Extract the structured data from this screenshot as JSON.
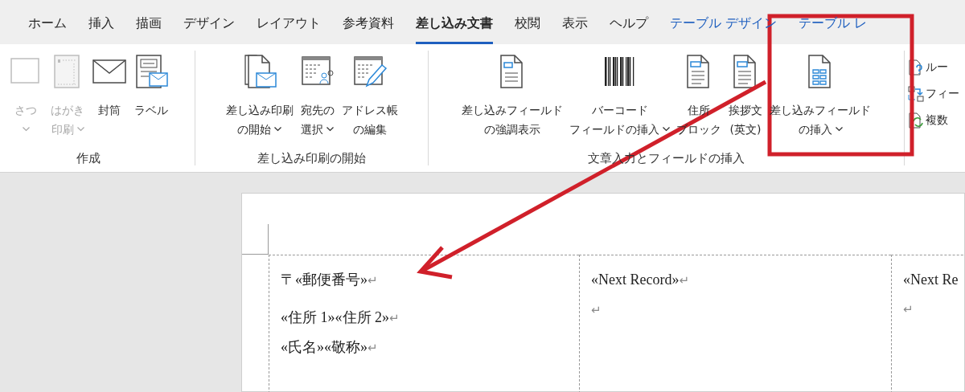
{
  "tabs": [
    {
      "label": "ホーム",
      "selected": false,
      "kind": "normal"
    },
    {
      "label": "挿入",
      "selected": false,
      "kind": "normal"
    },
    {
      "label": "描画",
      "selected": false,
      "kind": "normal"
    },
    {
      "label": "デザイン",
      "selected": false,
      "kind": "normal"
    },
    {
      "label": "レイアウト",
      "selected": false,
      "kind": "normal"
    },
    {
      "label": "参考資料",
      "selected": false,
      "kind": "normal"
    },
    {
      "label": "差し込み文書",
      "selected": true,
      "kind": "normal"
    },
    {
      "label": "校閲",
      "selected": false,
      "kind": "normal"
    },
    {
      "label": "表示",
      "selected": false,
      "kind": "normal"
    },
    {
      "label": "ヘルプ",
      "selected": false,
      "kind": "normal"
    },
    {
      "label": "テーブル デザイン",
      "selected": false,
      "kind": "contextual"
    },
    {
      "label": "テーブル レ",
      "selected": false,
      "kind": "contextual"
    }
  ],
  "ribbon_groups": [
    {
      "label": "作成",
      "buttons": [
        {
          "kind": "card",
          "lines": [
            "さつ"
          ],
          "caret": true,
          "disabled": true
        },
        {
          "kind": "postcard",
          "lines": [
            "はがき",
            "印刷"
          ],
          "caret": true,
          "disabled": true
        },
        {
          "kind": "envelope",
          "lines": [
            "封筒"
          ],
          "caret": false,
          "disabled": false
        },
        {
          "kind": "label",
          "lines": [
            "ラベル"
          ],
          "caret": false,
          "disabled": false
        }
      ]
    },
    {
      "label": "差し込み印刷の開始",
      "buttons": [
        {
          "kind": "merge",
          "lines": [
            "差し込み印刷",
            "の開始"
          ],
          "caret": true,
          "disabled": false
        },
        {
          "kind": "recipients",
          "lines": [
            "宛先の",
            "選択"
          ],
          "caret": true,
          "disabled": false
        },
        {
          "kind": "list",
          "lines": [
            "アドレス帳",
            "の編集"
          ],
          "caret": false,
          "disabled": false
        }
      ]
    },
    {
      "label": "文章入力とフィールドの挿入",
      "buttons": [
        {
          "kind": "highlight",
          "lines": [
            "差し込みフィールド",
            "の強調表示"
          ],
          "caret": false,
          "disabled": false
        },
        {
          "kind": "barcode",
          "lines": [
            "バーコード",
            "フィールドの挿入"
          ],
          "caret": true,
          "disabled": false
        },
        {
          "kind": "block",
          "lines": [
            "住所",
            "ブロック"
          ],
          "caret": false,
          "disabled": false
        },
        {
          "kind": "block",
          "lines": [
            "挨拶文",
            "(英文)"
          ],
          "caret": false,
          "disabled": false
        },
        {
          "kind": "field",
          "lines": [
            "差し込みフィールド",
            "の挿入"
          ],
          "caret": true,
          "disabled": false
        }
      ]
    }
  ],
  "small_buttons": [
    {
      "kind": "rules",
      "label": "ルー"
    },
    {
      "kind": "match",
      "label": "フィー"
    },
    {
      "kind": "update",
      "label": "複数"
    }
  ],
  "document": {
    "cells": [
      {
        "paragraphs": [
          {
            "text": "〒«郵便番号»",
            "mark": "↵"
          },
          {
            "text": "«住所 1»«住所 2»",
            "mark": "↵"
          },
          {
            "text": "«氏名»«敬称»",
            "mark": "↵"
          }
        ]
      },
      {
        "paragraphs": [
          {
            "text": "«Next Record»",
            "mark": "↵"
          },
          {
            "mark": "↵"
          }
        ]
      },
      {
        "paragraphs": [
          {
            "text": "«Next Re"
          },
          {
            "mark": "↵"
          }
        ]
      }
    ]
  }
}
